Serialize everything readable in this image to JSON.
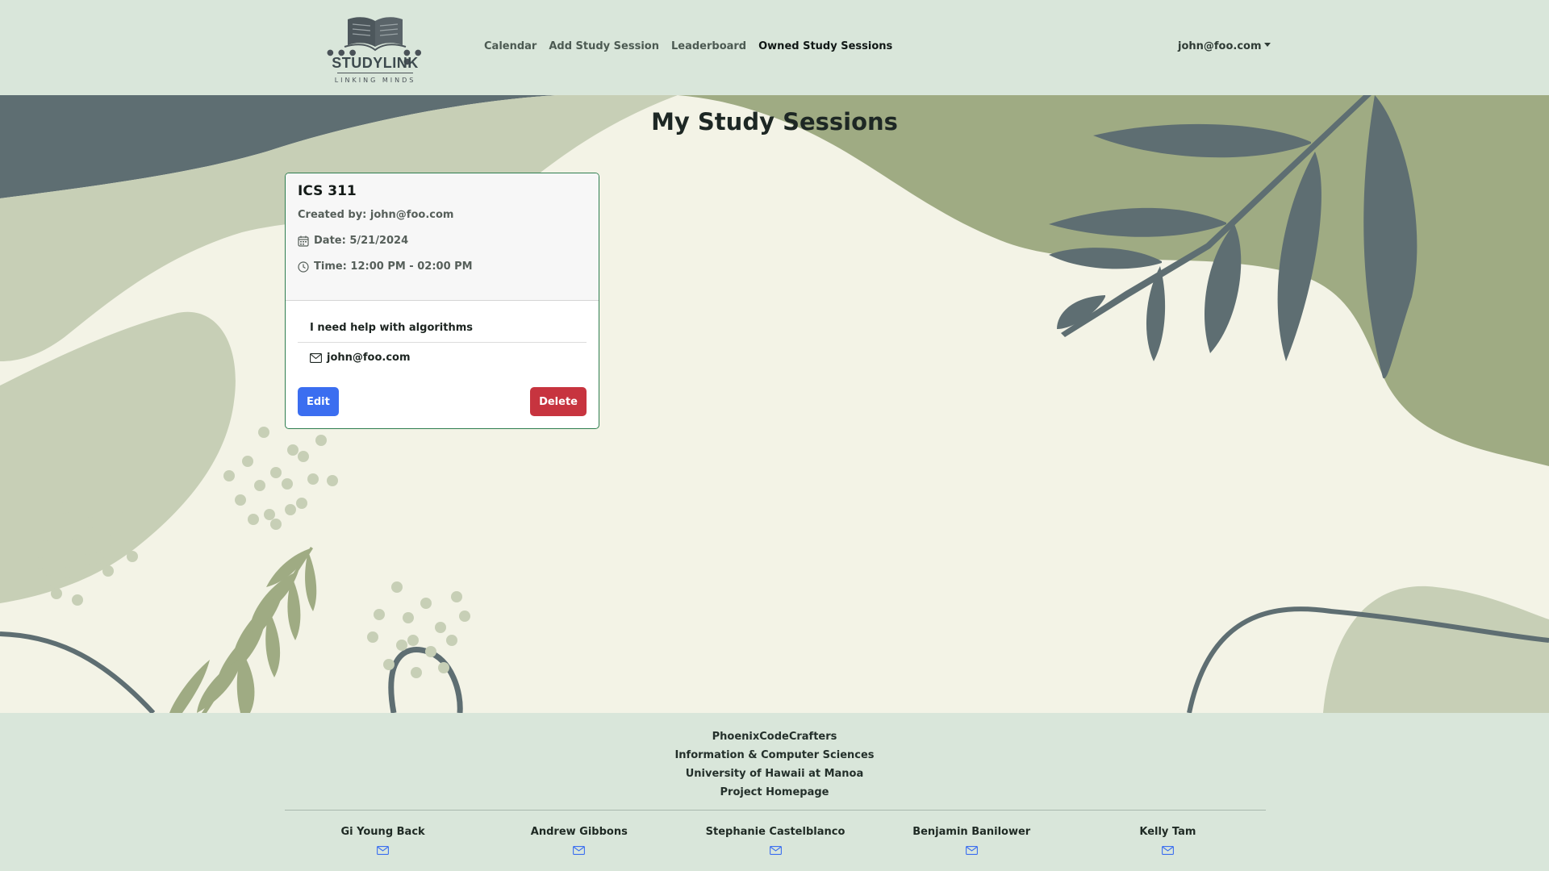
{
  "header": {
    "logo": {
      "title": "STUDYLINK",
      "tagline": "LINKING MINDS"
    },
    "nav": [
      {
        "label": "Calendar",
        "active": false
      },
      {
        "label": "Add Study Session",
        "active": false
      },
      {
        "label": "Leaderboard",
        "active": false
      },
      {
        "label": "Owned Study Sessions",
        "active": true
      }
    ],
    "user": "john@foo.com"
  },
  "main": {
    "title": "My Study Sessions",
    "session": {
      "course": "ICS 311",
      "created_by": "Created by: john@foo.com",
      "date": "Date: 5/21/2024",
      "time": "Time: 12:00 PM - 02:00 PM",
      "description": "I need help with algorithms",
      "email": "john@foo.com",
      "edit_label": "Edit",
      "delete_label": "Delete"
    }
  },
  "footer": {
    "lines": [
      "PhoenixCodeCrafters",
      "Information & Computer Sciences",
      "University of Hawaii at Manoa",
      "Project Homepage"
    ],
    "team": [
      "Gi Young Back",
      "Andrew Gibbons",
      "Stephanie Castelblanco",
      "Benjamin Banilower",
      "Kelly Tam"
    ]
  },
  "colors": {
    "header_bg": "#d9e6da",
    "page_bg": "#f3f3e6",
    "edit": "#3b6ef0",
    "delete": "#c7343f",
    "card_border": "#2e7d4f",
    "leaf_dark": "#5e6e72",
    "leaf_olive": "#9fab83"
  },
  "icons": {
    "calendar": "calendar-icon",
    "clock": "clock-icon",
    "envelope": "envelope-icon",
    "dropdown": "chevron-down-icon"
  }
}
